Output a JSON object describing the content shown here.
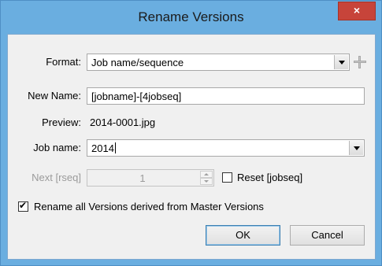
{
  "window": {
    "title": "Rename Versions",
    "close_glyph": "×"
  },
  "format": {
    "label": "Format:",
    "value": "Job name/sequence",
    "add_icon": "plus-icon"
  },
  "new_name": {
    "label": "New Name:",
    "value": "[jobname]-[4jobseq]"
  },
  "preview": {
    "label": "Preview:",
    "value": "2014-0001.jpg"
  },
  "job_name": {
    "label": "Job name:",
    "value": "2014"
  },
  "next_rseq": {
    "label": "Next [rseq]",
    "value": "1",
    "enabled": false
  },
  "reset_jobseq": {
    "label": "Reset [jobseq]",
    "checked": false
  },
  "rename_all": {
    "label": "Rename all Versions derived from Master Versions",
    "checked": true
  },
  "buttons": {
    "ok": "OK",
    "cancel": "Cancel"
  }
}
